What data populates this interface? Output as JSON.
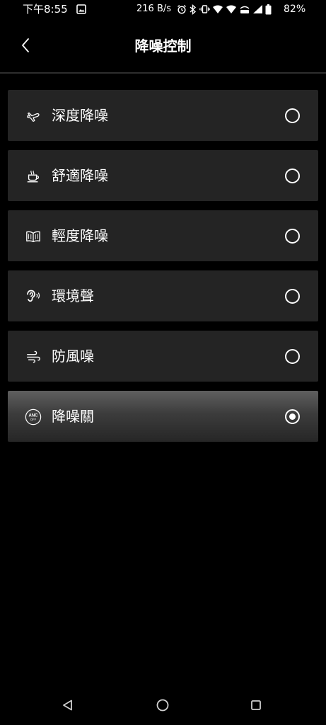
{
  "status_bar": {
    "time": "下午8:55",
    "network_speed": "216 B/s",
    "battery": "82%"
  },
  "header": {
    "title": "降噪控制"
  },
  "options": [
    {
      "label": "深度降噪",
      "icon": "airplane-icon",
      "selected": false
    },
    {
      "label": "舒適降噪",
      "icon": "coffee-cup-icon",
      "selected": false
    },
    {
      "label": "輕度降噪",
      "icon": "open-book-icon",
      "selected": false
    },
    {
      "label": "環境聲",
      "icon": "ear-sound-icon",
      "selected": false
    },
    {
      "label": "防風噪",
      "icon": "wind-icon",
      "selected": false
    },
    {
      "label": "降噪關",
      "icon": "anc-off-icon",
      "icon_text_top": "ANC",
      "icon_text_bottom": "OFF",
      "selected": true
    }
  ],
  "colors": {
    "background": "#000000",
    "card": "#242424",
    "card_selected_top": "#5f5f5f",
    "text": "#ffffff"
  }
}
